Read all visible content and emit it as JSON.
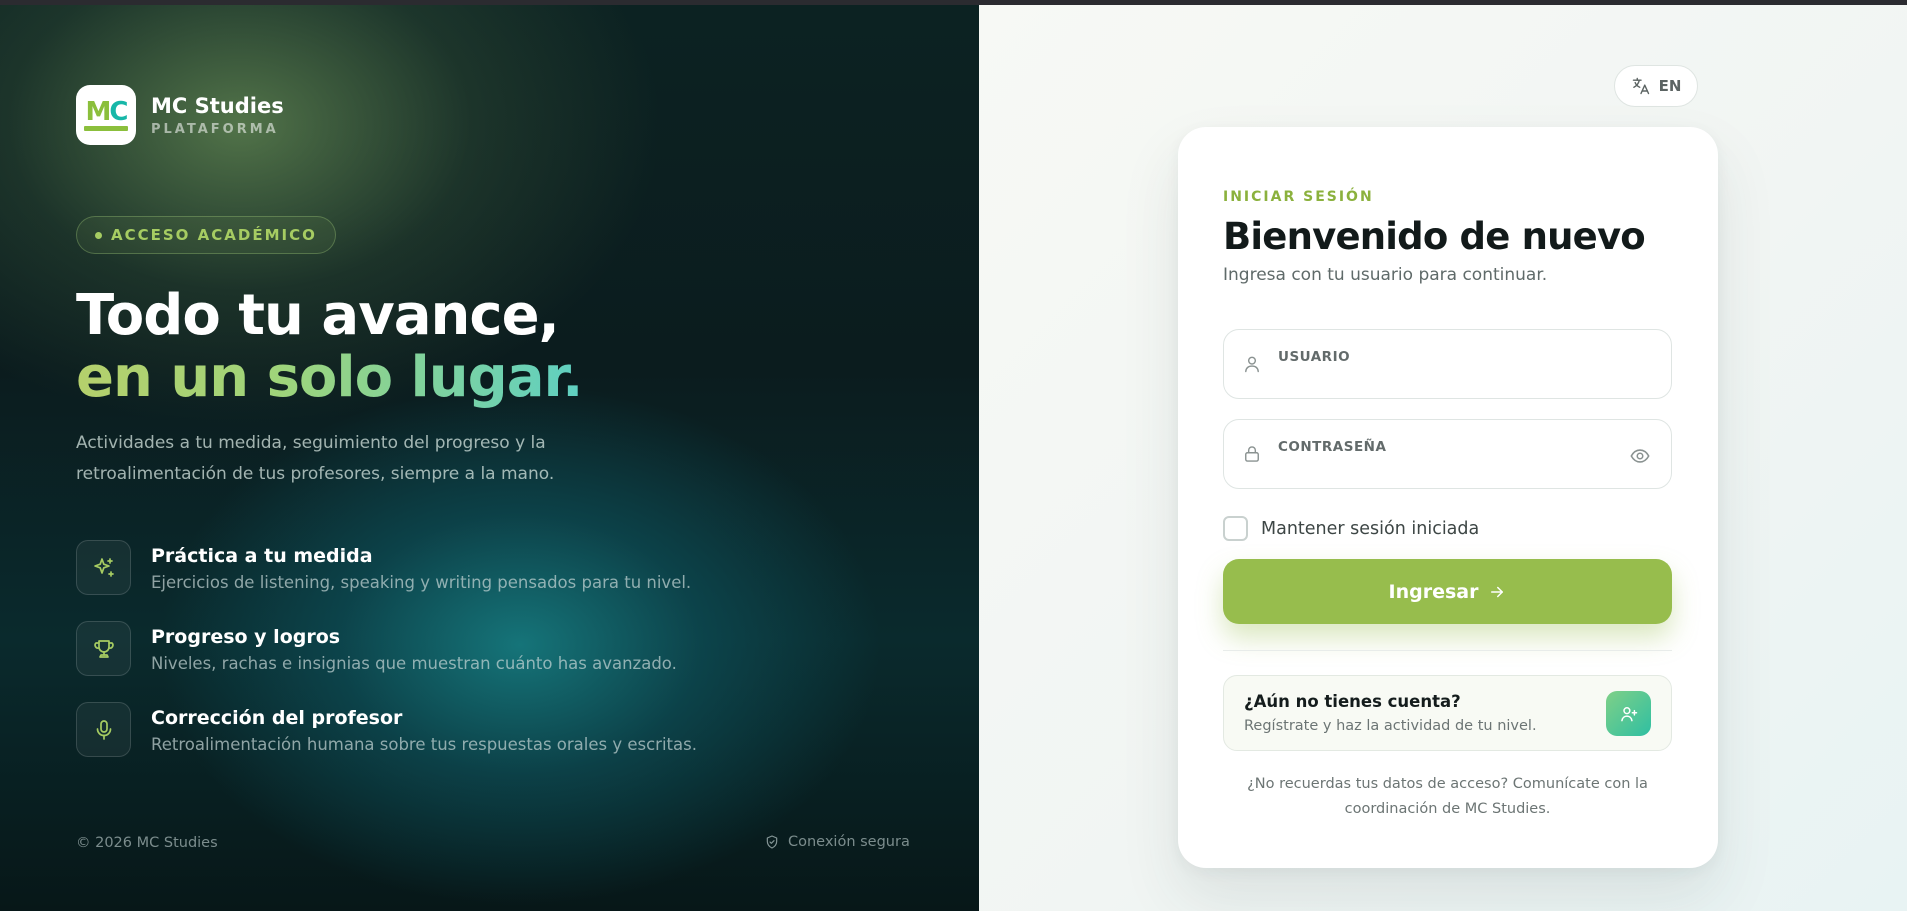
{
  "brand": {
    "logo_text_m": "M",
    "logo_text_c": "C",
    "name": "MC Studies",
    "subtitle": "PLATAFORMA"
  },
  "hero": {
    "pill": "ACCESO ACADÉMICO",
    "headline_line1": "Todo tu avance,",
    "headline_line2": "en un solo lugar.",
    "lead": "Actividades a tu medida, seguimiento del progreso y la retroalimentación de tus profesores, siempre a la mano.",
    "features": [
      {
        "icon": "sparkles-icon",
        "title": "Práctica a tu medida",
        "desc": "Ejercicios de listening, speaking y writing pensados para tu nivel."
      },
      {
        "icon": "trophy-icon",
        "title": "Progreso y logros",
        "desc": "Niveles, rachas e insignias que muestran cuánto has avanzado."
      },
      {
        "icon": "microphone-icon",
        "title": "Corrección del profesor",
        "desc": "Retroalimentación humana sobre tus respuestas orales y escritas."
      }
    ]
  },
  "footer": {
    "copyright": "© 2026 MC Studies",
    "secure": "Conexión segura"
  },
  "lang": {
    "icon": "translate-icon",
    "label": "EN"
  },
  "login": {
    "eyebrow": "INICIAR SESIÓN",
    "title": "Bienvenido de nuevo",
    "subtitle": "Ingresa con tu usuario para continuar.",
    "username_label": "USUARIO",
    "password_label": "CONTRASEÑA",
    "remember_label": "Mantener sesión iniciada",
    "remember_checked": false,
    "submit_label": "Ingresar",
    "register_title": "¿Aún no tienes cuenta?",
    "register_sub": "Regístrate y haz la actividad de tu nivel.",
    "help_text": "¿No recuerdas tus datos de acceso? Comunícate con la coordinación de MC Studies."
  },
  "colors": {
    "accent_green": "#97bd4d",
    "accent_teal": "#2fbfa2",
    "eyebrow_green": "#8bb13d"
  }
}
